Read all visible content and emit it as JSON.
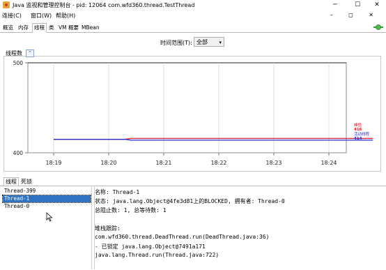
{
  "window": {
    "title": "Java 监视和管理控制台 - pid: 12064 com.wfd360.thread.TestThread",
    "minimize": "─",
    "maximize": "☐",
    "close": "✕"
  },
  "menu": [
    {
      "label": "连接(C)"
    },
    {
      "label": "窗口(W)"
    },
    {
      "label": "帮助(H)"
    }
  ],
  "mdi_controls": "–  ◻  ✕",
  "tabs": [
    {
      "label": "概览"
    },
    {
      "label": "内存"
    },
    {
      "label": "线程"
    },
    {
      "label": "类"
    },
    {
      "label": "VM 概要"
    },
    {
      "label": "MBean"
    }
  ],
  "time_range": {
    "label": "时间范围(T):",
    "value": "全部"
  },
  "chart_data": {
    "type": "line",
    "title": "线程数",
    "x_ticks": [
      "18:19",
      "18:20",
      "18:21",
      "18:22",
      "18:23",
      "18:24"
    ],
    "y_ticks": [
      400,
      500
    ],
    "ylim": [
      400,
      500
    ],
    "grid": true,
    "series": [
      {
        "name": "峰值",
        "value_label": "416",
        "color": "#e0202a",
        "points": [
          [
            0,
            415
          ],
          [
            1.3,
            415
          ],
          [
            1.4,
            416
          ],
          [
            5.8,
            416
          ]
        ]
      },
      {
        "name": "活动线程",
        "value_label": "414",
        "color": "#2a2ad0",
        "points": [
          [
            0,
            415
          ],
          [
            1.3,
            415
          ],
          [
            1.4,
            414
          ],
          [
            5.8,
            414
          ]
        ]
      }
    ]
  },
  "bottom_tabs": [
    {
      "label": "线程"
    },
    {
      "label": "死锁"
    }
  ],
  "threads": [
    "Thread-399",
    "Thread-1",
    "Thread-0"
  ],
  "details": {
    "name": "名称:  Thread-1",
    "state": "状态:  java.lang.Object@4fe3d81上的BLOCKED, 拥有者:  Thread-0",
    "counts": "总阻止数:  1, 总等待数:  1",
    "stack_title": "堆栈跟踪:",
    "stack": [
      "com.wfd360.thread.DeadThread.run(DeadThread.java:36)",
      "   - 已锁定 java.lang.Object@7491a171",
      "java.lang.Thread.run(Thread.java:722)"
    ]
  },
  "icons": {
    "app": "java-icon",
    "connection": "connection-icon",
    "cursor": "mouse-cursor-icon"
  }
}
